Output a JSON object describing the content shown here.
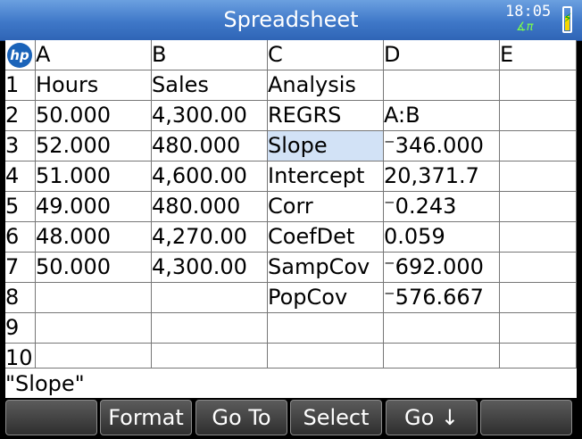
{
  "app": {
    "title": "Spreadsheet",
    "clock": "18:05",
    "mode": "∡π",
    "logo_text": "hp"
  },
  "columns": [
    "A",
    "B",
    "C",
    "D",
    "E"
  ],
  "rows": [
    {
      "num": "1",
      "cells": [
        "Hours",
        "Sales",
        "Analysis",
        "",
        ""
      ]
    },
    {
      "num": "2",
      "cells": [
        "50.000",
        "4,300.00",
        "REGRS",
        "A:B",
        ""
      ]
    },
    {
      "num": "3",
      "cells": [
        "52.000",
        "480.000",
        "Slope",
        "⁻346.000",
        ""
      ]
    },
    {
      "num": "4",
      "cells": [
        "51.000",
        "4,600.00",
        "Intercept",
        "20,371.7",
        ""
      ]
    },
    {
      "num": "5",
      "cells": [
        "49.000",
        "480.000",
        "Corr",
        "⁻0.243",
        ""
      ]
    },
    {
      "num": "6",
      "cells": [
        "48.000",
        "4,270.00",
        "CoefDet",
        "0.059",
        ""
      ]
    },
    {
      "num": "7",
      "cells": [
        "50.000",
        "4,300.00",
        "SampCov",
        "⁻692.000",
        ""
      ]
    },
    {
      "num": "8",
      "cells": [
        "",
        "",
        "PopCov",
        "⁻576.667",
        ""
      ]
    },
    {
      "num": "9",
      "cells": [
        "",
        "",
        "",
        "",
        ""
      ]
    },
    {
      "num": "10",
      "cells": [
        "",
        "",
        "",
        "",
        ""
      ]
    }
  ],
  "selected_cell": "C3",
  "status_text": "\"Slope\"",
  "softkeys": [
    "",
    "Format",
    "Go To",
    "Select",
    "Go ↓",
    ""
  ],
  "colors": {
    "title_bar": "#3f78c8",
    "selection": "#d2e2f6",
    "battery": "#f5d600"
  }
}
